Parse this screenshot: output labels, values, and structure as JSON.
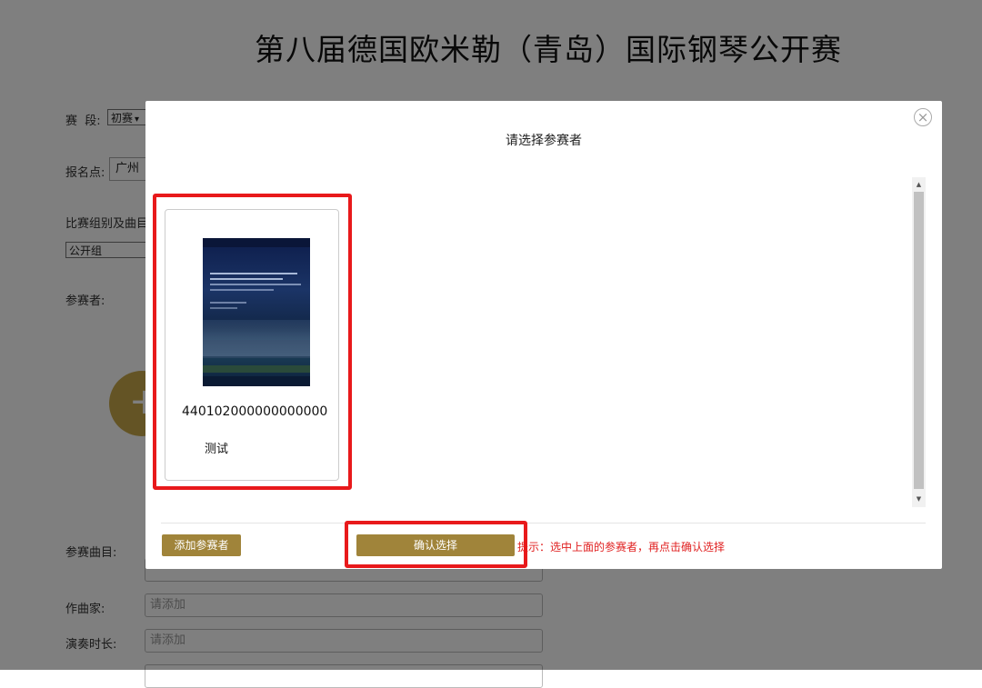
{
  "page": {
    "title": "第八届德国欧米勒（青岛）国际钢琴公开赛",
    "stage_label": "赛  段:",
    "stage_value": "初赛",
    "venue_label": "报名点:",
    "venue_value": "广州",
    "group_label": "比赛组别及曲目",
    "group_value": "公开组",
    "participant_label": "参赛者:",
    "add_symbol": "+",
    "piece_label": "参赛曲目:",
    "composer_label": "作曲家:",
    "composer_placeholder": "请添加",
    "duration_label": "演奏时长:",
    "duration_placeholder": "请添加"
  },
  "modal": {
    "title": "请选择参赛者",
    "close_symbol": "×",
    "card": {
      "id_number": "440102000000000000",
      "name": "测试"
    },
    "add_button_label": "添加参赛者",
    "confirm_button_label": "确认选择",
    "hint_text": "提示：选中上面的参赛者，再点击确认选择"
  },
  "colors": {
    "accent": "#a0843a",
    "highlight": "#e8191b",
    "hint": "#e02020"
  }
}
